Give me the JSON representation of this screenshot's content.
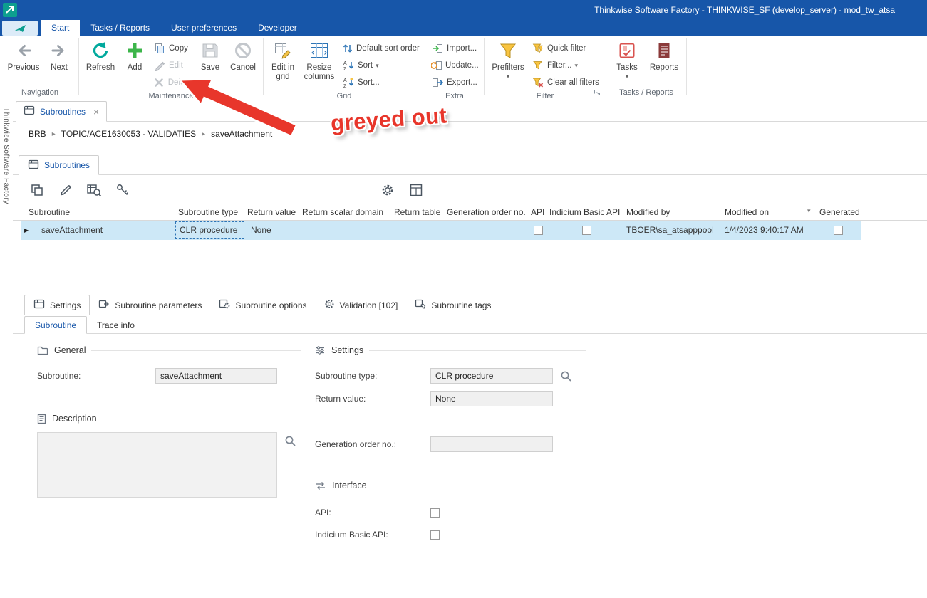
{
  "colors": {
    "titlebar": "#1756a9",
    "accent": "#1756a9",
    "selection": "#cde8f7",
    "teal": "#00a99d",
    "green": "#3cb54a",
    "funnel-yellow": "#f9c440",
    "annotation-red": "#e8362b",
    "disabled": "#c3c7cc"
  },
  "titlebar": {
    "title": "Thinkwise Software Factory - THINKWISE_SF (develop_server) - mod_tw_atsa"
  },
  "ribbon_tabs": {
    "start": "Start",
    "tasks_reports": "Tasks / Reports",
    "user_preferences": "User preferences",
    "developer": "Developer"
  },
  "ribbon": {
    "navigation": {
      "label": "Navigation",
      "previous": "Previous",
      "next": "Next"
    },
    "maintenance": {
      "label": "Maintenance",
      "refresh": "Refresh",
      "add": "Add",
      "copy": "Copy",
      "edit": "Edit",
      "delete": "Delete",
      "save": "Save",
      "cancel": "Cancel"
    },
    "grid": {
      "label": "Grid",
      "edit_in_grid": "Edit in grid",
      "resize_columns": "Resize columns",
      "default_sort_order": "Default sort order",
      "sort": "Sort",
      "sort_ellipsis": "Sort..."
    },
    "extra": {
      "label": "Extra",
      "import": "Import...",
      "update": "Update...",
      "export": "Export..."
    },
    "filter": {
      "label": "Filter",
      "prefilters": "Prefilters",
      "quick_filter": "Quick filter",
      "filter": "Filter...",
      "clear_all_filters": "Clear all filters"
    },
    "tasks_reports": {
      "label": "Tasks / Reports",
      "tasks": "Tasks",
      "reports": "Reports"
    }
  },
  "annotation": {
    "text": "greyed out"
  },
  "side_rail": {
    "text": "Thinkwise Software Factory"
  },
  "document_tab": {
    "label": "Subroutines"
  },
  "breadcrumb": {
    "items": [
      "BRB",
      "TOPIC/ACE1630053 - VALIDATIES",
      "saveAttachment"
    ]
  },
  "list_tab": {
    "label": "Subroutines"
  },
  "grid": {
    "columns": [
      "Subroutine",
      "Subroutine type",
      "Return value",
      "Return scalar domain",
      "Return table",
      "Generation order no.",
      "API",
      "Indicium Basic API",
      "Modified by",
      "Modified on",
      "Generated"
    ],
    "row": {
      "subroutine": "saveAttachment",
      "subroutine_type": "CLR procedure",
      "return_value": "None",
      "api_checked": false,
      "indicium_basic_api_checked": false,
      "modified_by": "TBOER\\sa_atsapppool",
      "modified_on": "1/4/2023 9:40:17 AM",
      "generated_checked": false
    }
  },
  "detail_tabs": {
    "settings": "Settings",
    "subroutine_parameters": "Subroutine parameters",
    "subroutine_options": "Subroutine options",
    "validation": "Validation [102]",
    "subroutine_tags": "Subroutine tags"
  },
  "sub_tabs": {
    "subroutine": "Subroutine",
    "trace_info": "Trace info"
  },
  "form": {
    "general": {
      "header": "General",
      "subroutine_label": "Subroutine:",
      "subroutine_value": "saveAttachment"
    },
    "description": {
      "header": "Description",
      "value": ""
    },
    "settings": {
      "header": "Settings",
      "subroutine_type_label": "Subroutine type:",
      "subroutine_type_value": "CLR procedure",
      "return_value_label": "Return value:",
      "return_value_value": "None",
      "generation_order_label": "Generation order no.:",
      "generation_order_value": ""
    },
    "interface": {
      "header": "Interface",
      "api_label": "API:",
      "api_checked": false,
      "indicium_label": "Indicium Basic API:",
      "indicium_checked": false
    }
  },
  "icons": {
    "dropdown_arrow": "▾",
    "close": "×",
    "breadcrumb_separator": "▸",
    "row_marker": "▶",
    "sort_indicator": "▾"
  }
}
